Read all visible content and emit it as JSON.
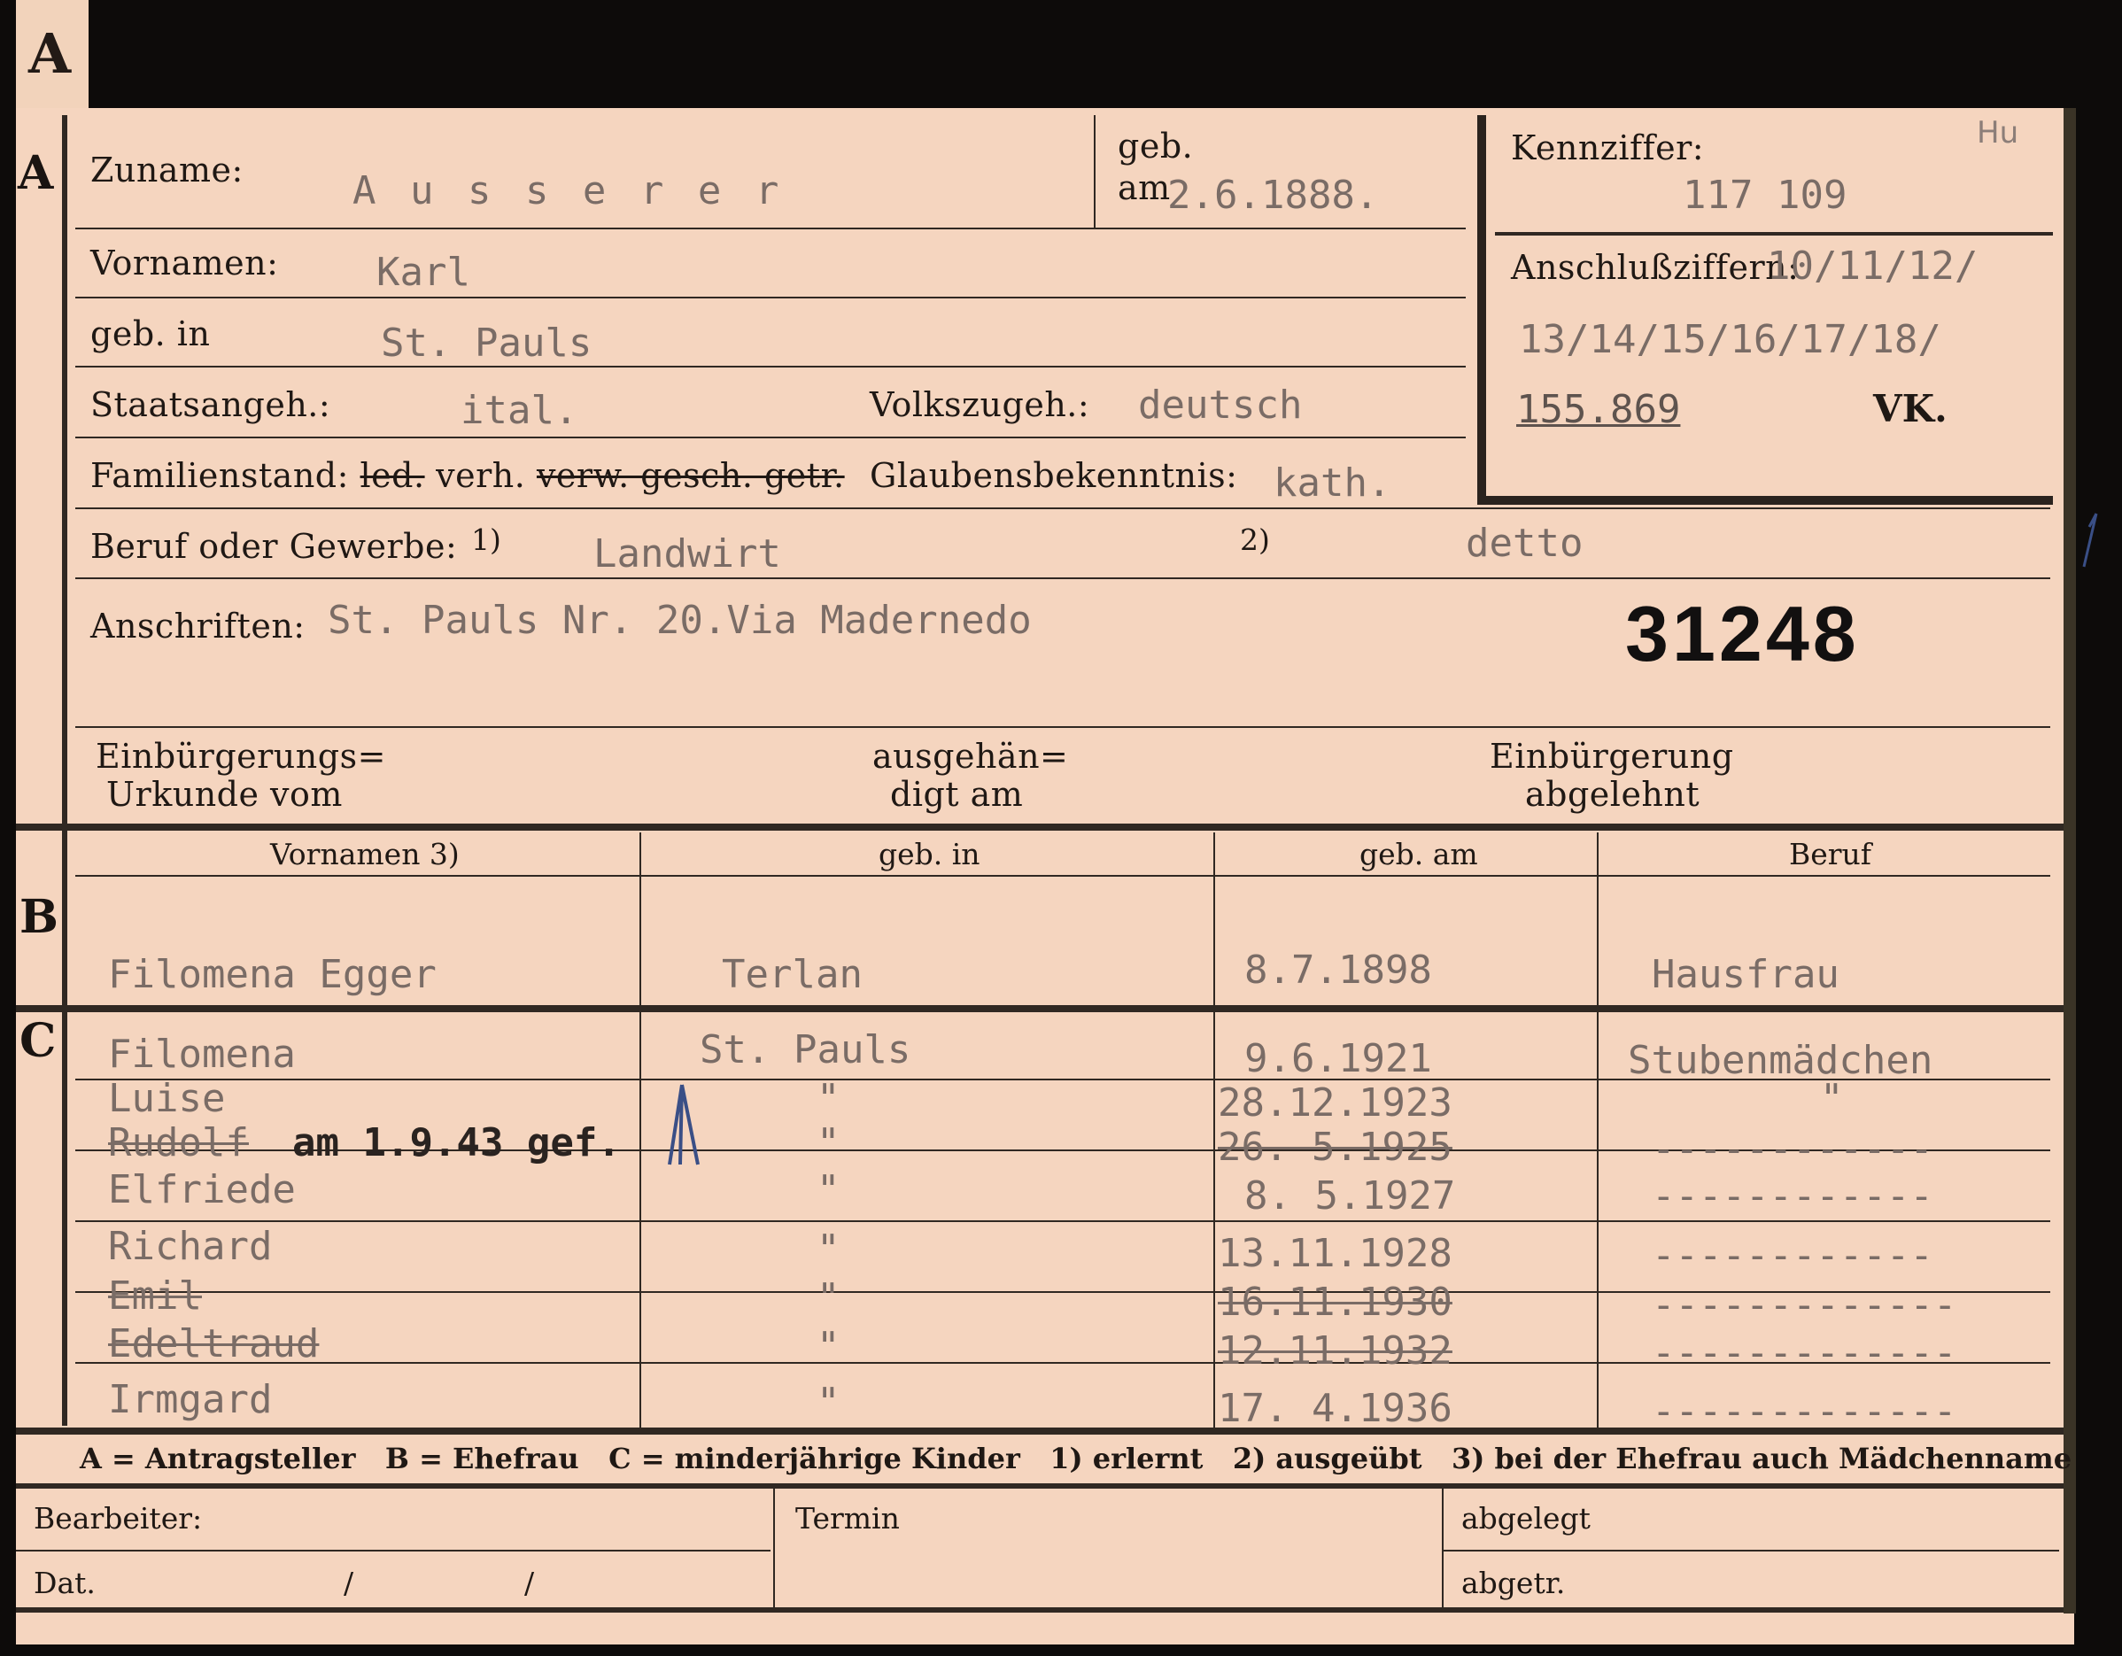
{
  "tab_letter": "A",
  "section_labels": {
    "a": "A",
    "b": "B",
    "c": "C"
  },
  "header": {
    "zuname_label": "Zuname:",
    "zuname_value": "A u s s e r e r",
    "geb_label": "geb.",
    "geb_am_label": "am",
    "geb_am_value": "2.6.1888.",
    "kennziffer_label": "Kennziffer:",
    "kennziffer_value": "117 109",
    "corner_mark": "Hu",
    "vornamen_label": "Vornamen:",
    "vornamen_value": "Karl",
    "geb_in_label": "geb. in",
    "geb_in_value": "St. Pauls",
    "staatsangeh_label": "Staatsangeh.:",
    "staatsangeh_value": "ital.",
    "volkszugeh_label": "Volkszugeh.:",
    "volkszugeh_value": "deutsch",
    "anschluss_label": "Anschlußziffern:",
    "anschluss_line1": "10/11/12/",
    "anschluss_line2": "13/14/15/16/17/18/",
    "anschluss_line3": "155.869",
    "vk": "VK.",
    "familienstand_label": "Familienstand:",
    "familienstand_ledig": "led.",
    "familienstand_verh": "verh.",
    "familienstand_rest": "verw. gesch. getr.",
    "glauben_label": "Glaubensbekenntnis:",
    "glauben_value": "kath.",
    "beruf_label": "Beruf oder Gewerbe:",
    "beruf_note1": "1)",
    "beruf_value": "Landwirt",
    "beruf_note2": "2)",
    "beruf_value2": "detto",
    "anschriften_label": "Anschriften:",
    "anschriften_value": "St. Pauls Nr. 20.Via Madernedo",
    "card_number": "31248",
    "einb_urkunde_l1": "Einbürgerungs=",
    "einb_urkunde_l2": "Urkunde vom",
    "ausgehaend_l1": "ausgehän=",
    "ausgehaend_l2": "digt am",
    "einb_abgelehnt_l1": "Einbürgerung",
    "einb_abgelehnt_l2": "abgelehnt"
  },
  "columns": {
    "vornamen": "Vornamen 3)",
    "geb_in": "geb. in",
    "geb_am": "geb. am",
    "beruf": "Beruf"
  },
  "spouse": {
    "name": "Filomena Egger",
    "place": "Terlan",
    "date": "8.7.1898",
    "job": "Hausfrau"
  },
  "children": [
    {
      "name": "Filomena",
      "place": "St. Pauls",
      "date": "9.6.1921",
      "job": "Stubenmädchen",
      "struck": false
    },
    {
      "name": "Luise",
      "place": "\"",
      "date": "28.12.1923",
      "job": "\"",
      "struck": false
    },
    {
      "name": "Rudolf",
      "note": "am 1.9.43 gef.",
      "place": "\"",
      "date": "26. 5.1925",
      "job": "------------",
      "struck": true
    },
    {
      "name": "Elfriede",
      "place": "\"",
      "date": "8. 5.1927",
      "job": "------------",
      "struck": false
    },
    {
      "name": "Richard",
      "place": "\"",
      "date": "13.11.1928",
      "job": "------------",
      "struck": false
    },
    {
      "name": "Emil",
      "place": "\"",
      "date": "16.11.1930",
      "job": "-------------",
      "struck": true
    },
    {
      "name": "Edeltraud",
      "place": "\"",
      "date": "12.11.1932",
      "job": "-------------",
      "struck": true
    },
    {
      "name": "Irmgard",
      "place": "\"",
      "date": "17. 4.1936",
      "job": "-------------",
      "struck": false
    }
  ],
  "legend": "A = Antragsteller   B = Ehefrau   C = minderjährige Kinder   1) erlernt   2) ausgeübt   3) bei der Ehefrau auch Mädchenname",
  "footer": {
    "bearbeiter": "Bearbeiter:",
    "termin": "Termin",
    "abgelegt": "abgelegt",
    "dat": "Dat.",
    "slash1": "/",
    "slash2": "/",
    "abgetr": "abgetr."
  },
  "colors": {
    "paper": "#f5d5bf",
    "ink": "#1f1814",
    "typewriter": "#7a6c66",
    "background": "#0d0b0a"
  }
}
